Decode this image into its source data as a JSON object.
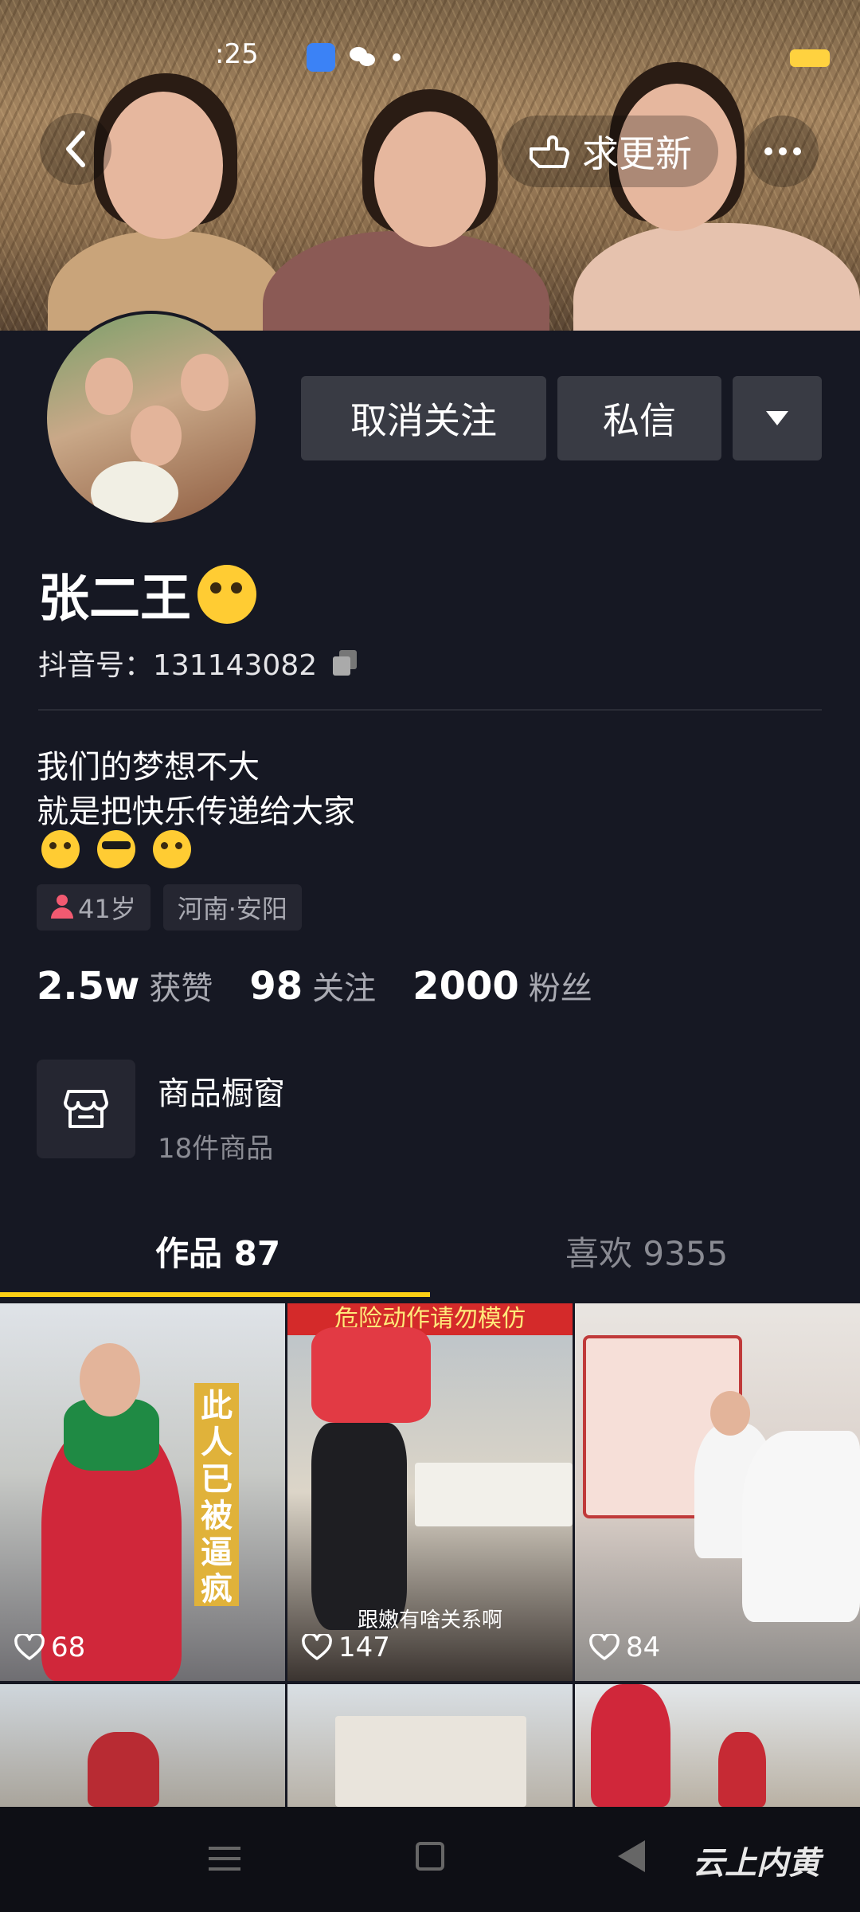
{
  "status_bar": {
    "time": ":25"
  },
  "header": {
    "update_label": "求更新"
  },
  "profile": {
    "name": "张二王",
    "douyin_id": "抖音号：131143082",
    "unfollow_label": "取消关注",
    "message_label": "私信",
    "bio_lines": [
      "我们的梦想不大",
      "就是把快乐传递给大家"
    ],
    "tags": {
      "age": "41岁",
      "location": "河南·安阳"
    },
    "stats": [
      {
        "value": "2.5w",
        "label": "获赞"
      },
      {
        "value": "98",
        "label": "关注"
      },
      {
        "value": "2000",
        "label": "粉丝"
      }
    ],
    "shop": {
      "title": "商品橱窗",
      "subtitle": "18件商品"
    }
  },
  "tabs": [
    {
      "label": "作品 87",
      "active": true
    },
    {
      "label": "喜欢 9355",
      "active": false
    }
  ],
  "videos": [
    {
      "likes": "68",
      "overlay": "此人已被逼疯"
    },
    {
      "likes": "147",
      "top_caption": "危险动作请勿模仿",
      "bottom_caption": "跟嫩有啥关系啊"
    },
    {
      "likes": "84"
    },
    {
      "likes": ""
    },
    {
      "likes": ""
    },
    {
      "likes": ""
    }
  ],
  "watermark": "云上内黄",
  "colors": {
    "background": "#161823",
    "accent": "#face15",
    "button": "#393b44"
  },
  "icons": [
    "back-icon",
    "hand-pointing-icon",
    "more-icon",
    "dropdown-icon",
    "copy-icon",
    "person-icon",
    "shop-icon",
    "heart-icon"
  ]
}
